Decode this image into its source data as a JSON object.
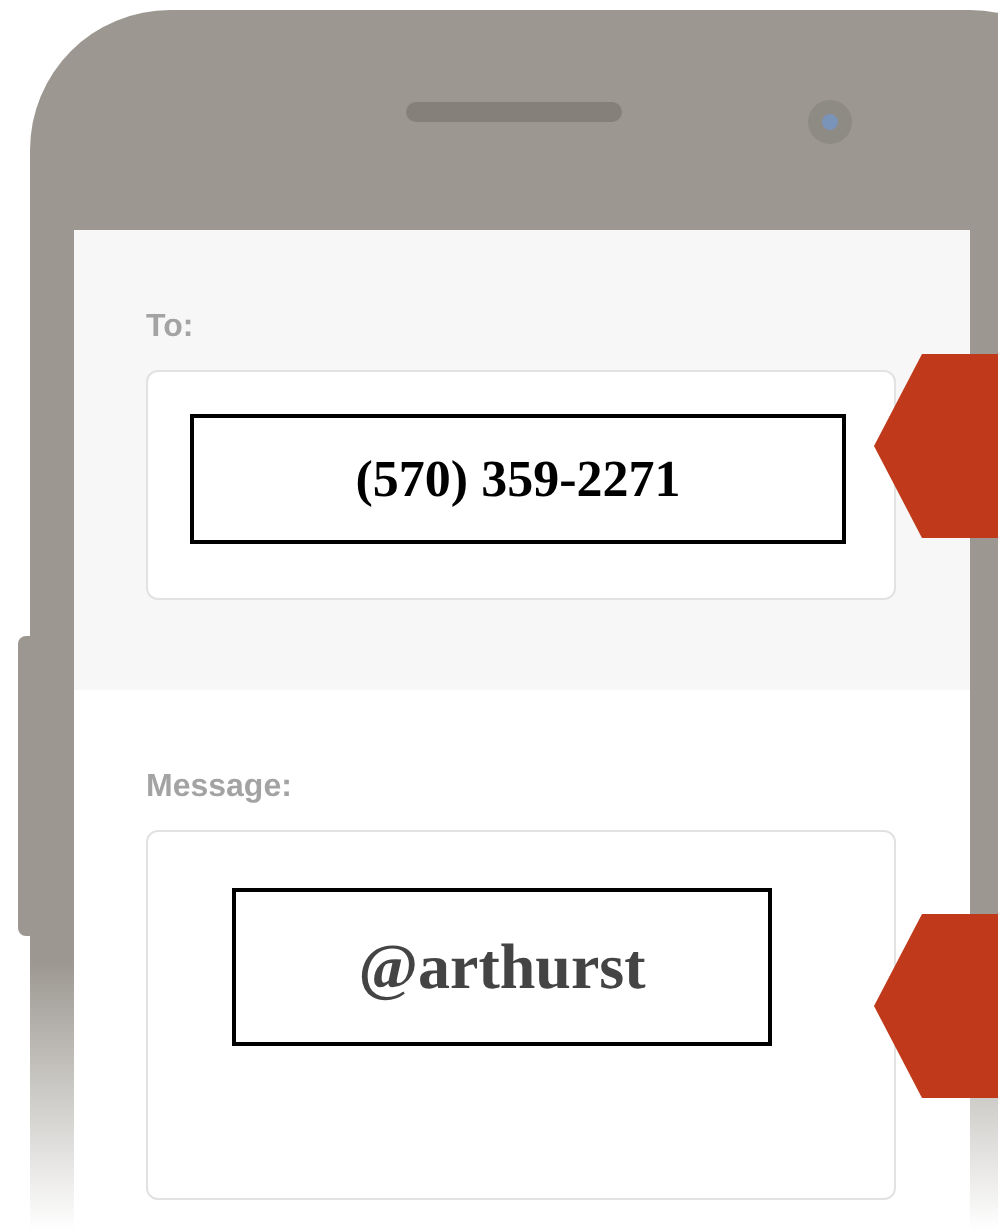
{
  "to": {
    "label": "To:",
    "value": "(570) 359-2271"
  },
  "message": {
    "label": "Message:",
    "value": "@arthurst"
  }
}
